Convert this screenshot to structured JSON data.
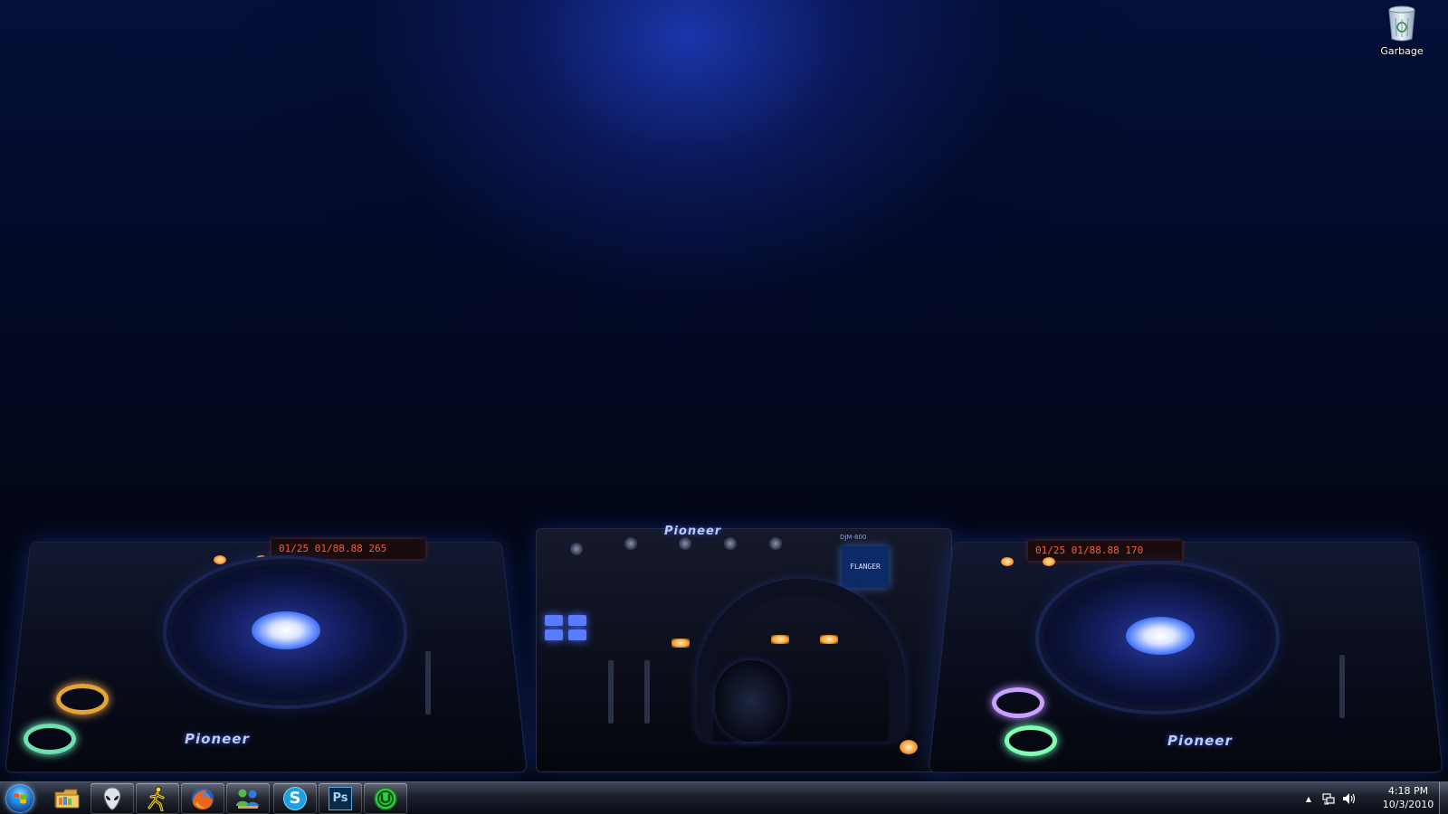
{
  "desktop": {
    "icons": [
      {
        "label": "Garbage",
        "icon": "recycle-bin-icon"
      }
    ],
    "wallpaper": {
      "deck_left_brand": "Pioneer",
      "deck_right_brand": "Pioneer",
      "deck_left_display": "01/25  01/88.88  265",
      "deck_right_display": "01/25  01/88.88  170",
      "mixer_brand": "Pioneer",
      "mixer_model": "DJM-800",
      "mixer_display": "FLANGER"
    }
  },
  "taskbar": {
    "start_icon": "windows-start-orb-icon",
    "pinned": [
      {
        "name": "Windows Explorer",
        "icon": "folder-icon"
      },
      {
        "name": "Alienware",
        "icon": "alien-head-icon"
      },
      {
        "name": "AIM",
        "icon": "running-man-icon"
      },
      {
        "name": "Firefox",
        "icon": "firefox-icon"
      },
      {
        "name": "Windows Live Messenger",
        "icon": "messenger-icon"
      },
      {
        "name": "Skype",
        "icon": "skype-icon",
        "glyph": "S"
      },
      {
        "name": "Photoshop",
        "icon": "photoshop-icon",
        "glyph": "Ps"
      },
      {
        "name": "uTorrent",
        "icon": "utorrent-icon"
      }
    ],
    "tray": {
      "show_hidden_glyph": "▲",
      "network_icon": "network-icon",
      "volume_icon": "volume-icon"
    },
    "clock": {
      "time": "4:18 PM",
      "date": "10/3/2010"
    }
  },
  "colors": {
    "accent_blue": "#2f5bff",
    "photoshop_bg": "#0b2a4a",
    "skype_bg": "#1ba1e2",
    "utorrent_green": "#2ecc40"
  }
}
